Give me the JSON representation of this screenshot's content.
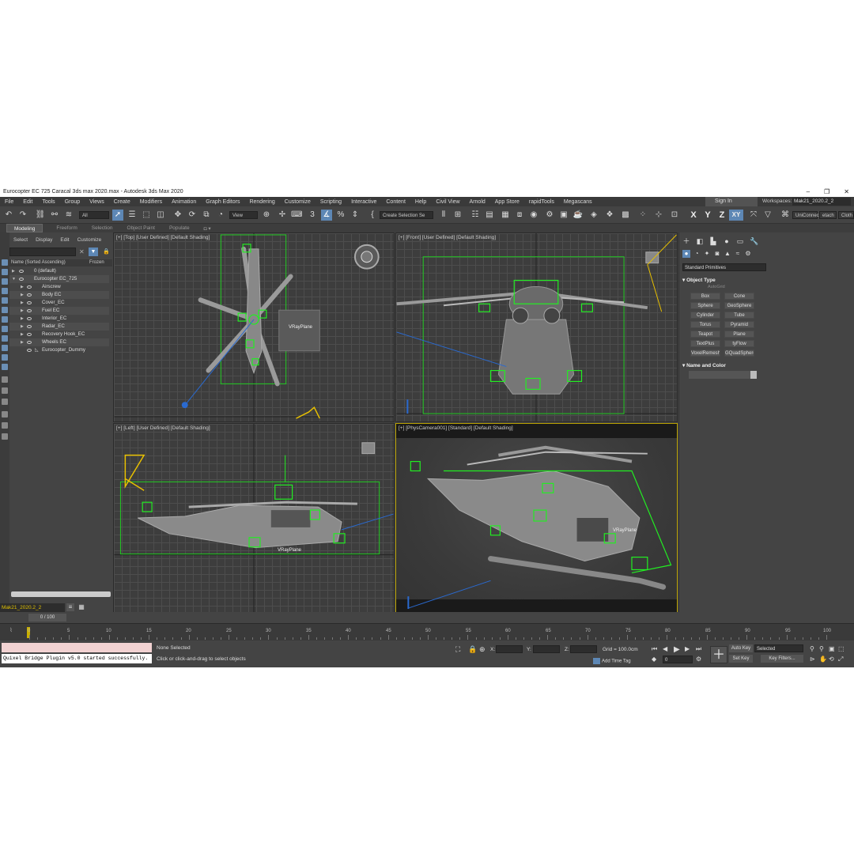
{
  "window": {
    "title": "Eurocopter EC 725 Caracal 3ds max 2020.max - Autodesk 3ds Max 2020",
    "min": "–",
    "max": "❐",
    "close": "✕"
  },
  "menu": [
    "File",
    "Edit",
    "Tools",
    "Group",
    "Views",
    "Create",
    "Modifiers",
    "Animation",
    "Graph Editors",
    "Rendering",
    "Customize",
    "Scripting",
    "Interactive",
    "Content",
    "Help",
    "Civil View",
    "Arnold",
    "App Store",
    "rapidTools",
    "Megascans"
  ],
  "account": {
    "sign_in": "Sign In",
    "workspaces_label": "Workspaces:",
    "workspace": "Mak21_2020.2_2"
  },
  "toolbar": {
    "filter": "All",
    "ref_coord": "View",
    "selection_set": "Create Selection Se",
    "axes": [
      "X",
      "Y",
      "Z",
      "XY"
    ],
    "right_tabs": [
      "UniConnec",
      "etach",
      "Cloth"
    ]
  },
  "ribbon": [
    "Modeling",
    "Freeform",
    "Selection",
    "Object Paint",
    "Populate"
  ],
  "explorer": {
    "menu": [
      "Select",
      "Display",
      "Edit",
      "Customize"
    ],
    "col_name": "Name (Sorted Ascending)",
    "col_frozen": "Frozen",
    "rows": [
      {
        "label": "0 (default)"
      },
      {
        "label": "Eurocopter EC_725"
      },
      {
        "label": "Airscrew"
      },
      {
        "label": "Body EC"
      },
      {
        "label": "Cover_EC"
      },
      {
        "label": "Fuel EC"
      },
      {
        "label": "Interior_EC"
      },
      {
        "label": "Radar_EC"
      },
      {
        "label": "Recovery Hook_EC"
      },
      {
        "label": "Wheels EC"
      },
      {
        "label": "Eurocopter_Dummy"
      }
    ],
    "layer": "Mak21_2020.2_2"
  },
  "viewports": {
    "top": {
      "label": "[+] [Top] [User Defined] [Default Shading]",
      "tag": "VRayPlane"
    },
    "front": {
      "label": "[+] [Front] [User Defined] [Default Shading]"
    },
    "left": {
      "label": "[+] [Left] [User Defined] [Default Shading]",
      "tag": "VRayPlane"
    },
    "persp": {
      "label": "[+] [PhysCamera001] [Standard] [Default Shading]",
      "tag": "VRayPlane"
    }
  },
  "command_panel": {
    "category": "Standard Primitives",
    "object_type": "Object Type",
    "autogrid": "AutoGrid",
    "buttons": [
      "Box",
      "Cone",
      "Sphere",
      "GeoSphere",
      "Cylinder",
      "Tube",
      "Torus",
      "Pyramid",
      "Teapot",
      "Plane",
      "TextPlus",
      "tyFlow",
      "VoxelRemesh",
      "GQuadSphere"
    ],
    "name_color": "Name and Color"
  },
  "timeline": {
    "slider": "0 / 100",
    "ticks": [
      "0",
      "5",
      "10",
      "15",
      "20",
      "25",
      "30",
      "35",
      "40",
      "45",
      "50",
      "55",
      "60",
      "65",
      "70",
      "75",
      "80",
      "85",
      "90",
      "95",
      "100"
    ]
  },
  "status": {
    "maxscript": "Quixel Bridge Plugin v5.0 started successfully.",
    "selection": "None Selected",
    "prompt": "Click or click-and-drag to select objects",
    "x_label": "X:",
    "y_label": "Y:",
    "z_label": "Z:",
    "grid": "Grid = 100.0cm",
    "add_time_tag": "Add Time Tag",
    "frame": "0",
    "auto_key": "Auto Key",
    "set_key": "Set Key",
    "selected": "Selected",
    "key_filters": "Key Filters..."
  },
  "colors": {
    "selection": "#5d87b5",
    "helper_green": "#22dd22",
    "helper_yellow": "#e8c000",
    "camera_border": "#b9a100"
  }
}
